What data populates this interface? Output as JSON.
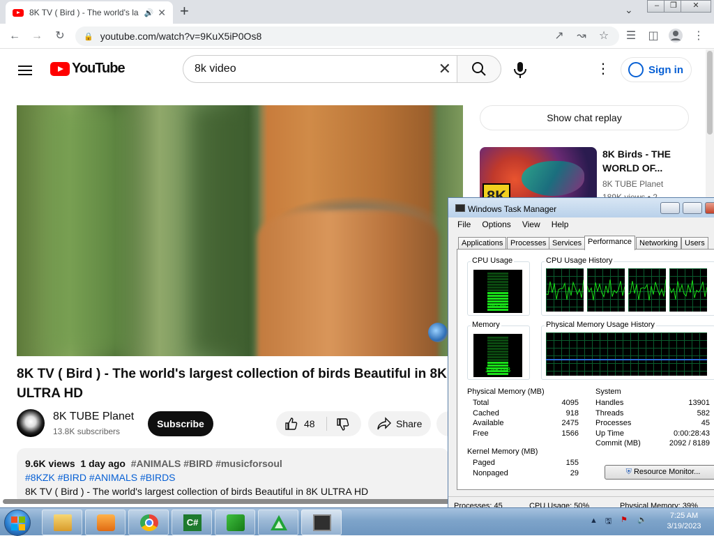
{
  "browser": {
    "tab_title": "8K TV ( Bird ) - The world's la",
    "url": "youtube.com/watch?v=9KuX5iP0Os8"
  },
  "youtube": {
    "logo_text": "YouTube",
    "search_value": "8k video",
    "signin": "Sign in",
    "video_title": "8K TV ( Bird ) - The world's largest collection of birds Beautiful in 8K ULTRA HD",
    "channel_name": "8K TUBE Planet",
    "subscribers": "13.8K subscribers",
    "subscribe": "Subscribe",
    "likes": "48",
    "share": "Share",
    "description": {
      "views": "9.6K views",
      "age": "1 day ago",
      "tags_line1": "#ANIMALS #BIRD #musicforsoul",
      "tags_line2": "#8KZK #BIRD #ANIMALS #BIRDS",
      "text": "8K TV ( Bird ) - The world's largest collection of birds Beautiful in 8K ULTRA HD"
    },
    "chat_replay": "Show chat replay",
    "recommendation": {
      "title": "8K Birds - THE WORLD OF...",
      "channel": "8K TUBE Planet",
      "views": "189K views • 2",
      "badge": "8K"
    }
  },
  "task_manager": {
    "title": "Windows Task Manager",
    "menu": [
      "File",
      "Options",
      "View",
      "Help"
    ],
    "tabs": [
      "Applications",
      "Processes",
      "Services",
      "Performance",
      "Networking",
      "Users"
    ],
    "active_tab": "Performance",
    "cpu_usage_label": "CPU Usage",
    "cpu_usage_value": "50 %",
    "cpu_usage_fraction": 0.5,
    "cpu_history_label": "CPU Usage History",
    "memory_label": "Memory",
    "memory_value": "1.58 GB",
    "memory_fraction": 0.39,
    "mem_history_label": "Physical Memory Usage History",
    "physical_memory": {
      "label": "Physical Memory (MB)",
      "rows": [
        [
          "Total",
          "4095"
        ],
        [
          "Cached",
          "918"
        ],
        [
          "Available",
          "2475"
        ],
        [
          "Free",
          "1566"
        ]
      ]
    },
    "system": {
      "label": "System",
      "rows": [
        [
          "Handles",
          "13901"
        ],
        [
          "Threads",
          "582"
        ],
        [
          "Processes",
          "45"
        ],
        [
          "Up Time",
          "0:00:28:43"
        ],
        [
          "Commit (MB)",
          "2092 / 8189"
        ]
      ]
    },
    "kernel_memory": {
      "label": "Kernel Memory (MB)",
      "rows": [
        [
          "Paged",
          "155"
        ],
        [
          "Nonpaged",
          "29"
        ]
      ]
    },
    "resource_monitor": "Resource Monitor...",
    "status": {
      "processes": "Processes: 45",
      "cpu": "CPU Usage: 50%",
      "memory": "Physical Memory: 39%"
    }
  },
  "taskbar": {
    "apps": [
      "explorer-icon",
      "media-player-icon",
      "chrome-icon",
      "csharp-icon",
      "green-app-icon",
      "triangle-app-icon",
      "task-manager-icon"
    ],
    "time": "7:25 AM",
    "date": "3/19/2023"
  }
}
